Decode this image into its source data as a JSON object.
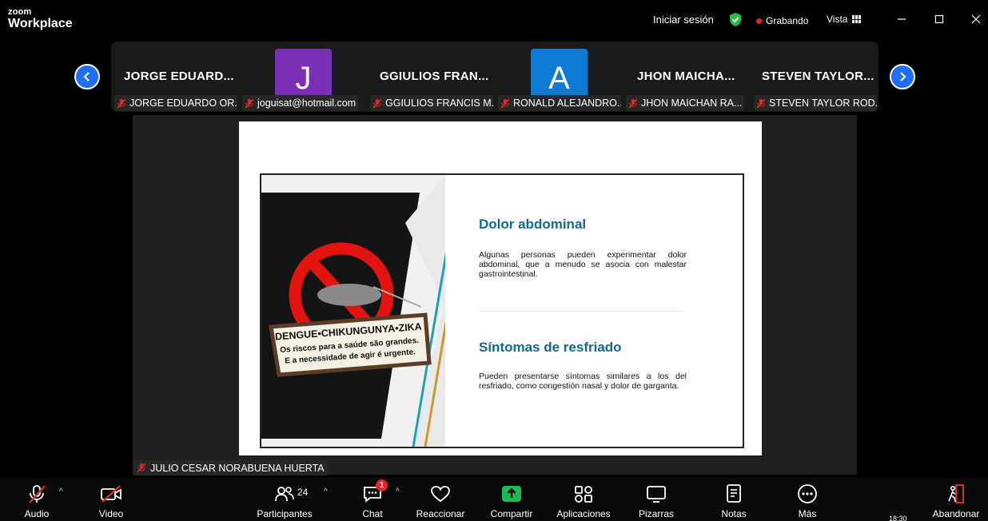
{
  "app": {
    "brand_top": "zoom",
    "brand_bottom": "Workplace"
  },
  "header": {
    "signin_label": "Iniciar sesión",
    "recording_label": "Grabando",
    "view_label": "Vista"
  },
  "participants": [
    {
      "display_name": "JORGE EDUARD...",
      "label": "JORGE EDUARDO OR...",
      "avatar_letter": "",
      "avatar_color": ""
    },
    {
      "display_name": "",
      "label": "joguisat@hotmail.com",
      "avatar_letter": "J",
      "avatar_color": "#7b2fb5"
    },
    {
      "display_name": "GGIULIOS FRAN...",
      "label": "GGIULIOS FRANCIS M...",
      "avatar_letter": "",
      "avatar_color": ""
    },
    {
      "display_name": "",
      "label": "RONALD ALEJANDRO...",
      "avatar_letter": "A",
      "avatar_color": "#0e7ad4"
    },
    {
      "display_name": "JHON  MAICHA...",
      "label": "JHON MAICHAN RA...",
      "avatar_letter": "",
      "avatar_color": ""
    },
    {
      "display_name": "STEVEN  TAYLOR...",
      "label": "STEVEN TAYLOR ROD...",
      "avatar_letter": "",
      "avatar_color": ""
    }
  ],
  "slide": {
    "heading1": "Dolor abdominal",
    "text1": "Algunas personas pueden experimentar dolor abdominal, que a menudo se asocia con malestar gastrointestinal.",
    "heading2": "Síntomas de resfriado",
    "text2": "Pueden presentarse síntomas similares a los del resfriado, como congestión nasal y dolor de garganta.",
    "poster_line1": "DENGUE•CHIKUNGUNYA•ZIKA",
    "poster_line2": "Os riscos para a saúde são grandes.",
    "poster_line3": "E a necessidade de agir é urgente."
  },
  "speaker": {
    "name": "JULIO CESAR NORABUENA HUERTA"
  },
  "toolbar": {
    "audio": "Audio",
    "video": "Video",
    "participants": "Participantes",
    "participants_count": "24",
    "chat": "Chat",
    "chat_badge": "1",
    "react": "Reaccionar",
    "share": "Compartir",
    "apps": "Aplicaciones",
    "whiteboards": "Pizarras",
    "notes": "Notas",
    "more": "Más",
    "leave": "Abandonar"
  },
  "taskbar": {
    "time": "18:30"
  },
  "colors": {
    "accent_blue": "#1f6ff5",
    "share_green": "#1db954",
    "record_red": "#e02828",
    "slide_heading": "#0e6b8c"
  }
}
